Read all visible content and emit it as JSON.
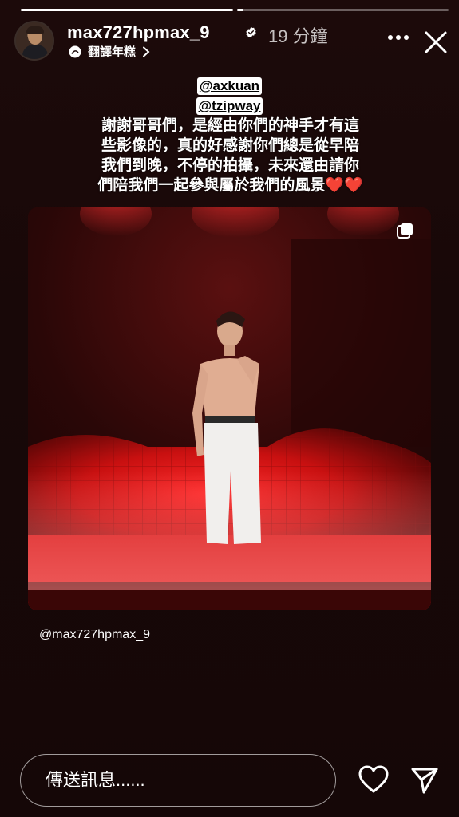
{
  "story": {
    "progress": [
      1.0,
      0.03
    ]
  },
  "header": {
    "username": "max727hpmax_9",
    "verified": true,
    "timestamp": "19 分鐘",
    "translate_label": "翻譯年糕",
    "more_icon": "more-horizontal-icon",
    "close_icon": "close-icon"
  },
  "caption": {
    "mentions": [
      "@axkuan",
      "@tzipway"
    ],
    "lines": [
      "謝謝哥哥們，是經由你們的神手才有這",
      "些影像的，真的好感謝你們總是從早陪",
      "我們到晚，不停的拍攝，未來還由請你",
      "們陪我們一起參與屬於我們的風景"
    ],
    "hearts": "❤️❤️"
  },
  "photo": {
    "multi_image_icon": "carousel-icon"
  },
  "credit": "@max727hpmax_9",
  "footer": {
    "message_placeholder": "傳送訊息......",
    "like_icon": "heart-icon",
    "share_icon": "send-icon"
  }
}
